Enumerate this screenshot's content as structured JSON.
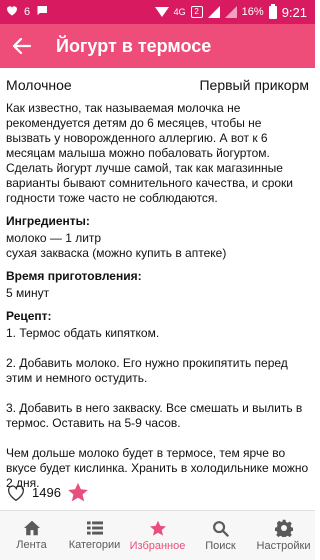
{
  "status": {
    "time": "9:21",
    "battery": "16%",
    "network": "4G",
    "sim": "2",
    "notification_count": "6"
  },
  "app_bar": {
    "title": "Йогурт в термосе"
  },
  "recipe": {
    "category": "Молочное",
    "tag": "Первый прикорм",
    "intro": "Как известно, так называемая молочка не рекомендуется детям до 6 месяцев, чтобы не вызвать у новорожденного аллергию. А вот к 6 месяцам малыша можно побаловать йогуртом. Сделать йогурт лучше самой, так как магазинные варианты бывают сомнительного качества, и сроки годности тоже часто не соблюдаются.",
    "ingredients_title": "Ингредиенты:",
    "ingredients": [
      "молоко — 1 литр",
      "сухая закваска (можно купить в аптеке)"
    ],
    "time_title": "Время приготовления:",
    "time_value": "5 минут",
    "steps_title": "Рецепт:",
    "steps": [
      "1. Термос обдать кипятком.",
      "2. Добавить молоко. Его нужно прокипятить перед этим и немного остудить.",
      "3. Добавить в него закваску. Все смешать и вылить в термос. Оставить на 5-9 часов.",
      "Чем дольше молоко будет в термосе, тем ярче во вкусе будет кислинка. Хранить в холодильнике можно 2 дня."
    ],
    "likes": "1496"
  },
  "nav": {
    "items": [
      {
        "label": "Лента",
        "icon": "home-icon"
      },
      {
        "label": "Категории",
        "icon": "list-icon"
      },
      {
        "label": "Избранное",
        "icon": "star-icon",
        "active": true
      },
      {
        "label": "Поиск",
        "icon": "search-icon"
      },
      {
        "label": "Настройки",
        "icon": "gear-icon"
      }
    ]
  },
  "colors": {
    "status_bar": "#d81b60",
    "app_bar": "#ee4d7a",
    "accent": "#e94f7c"
  }
}
